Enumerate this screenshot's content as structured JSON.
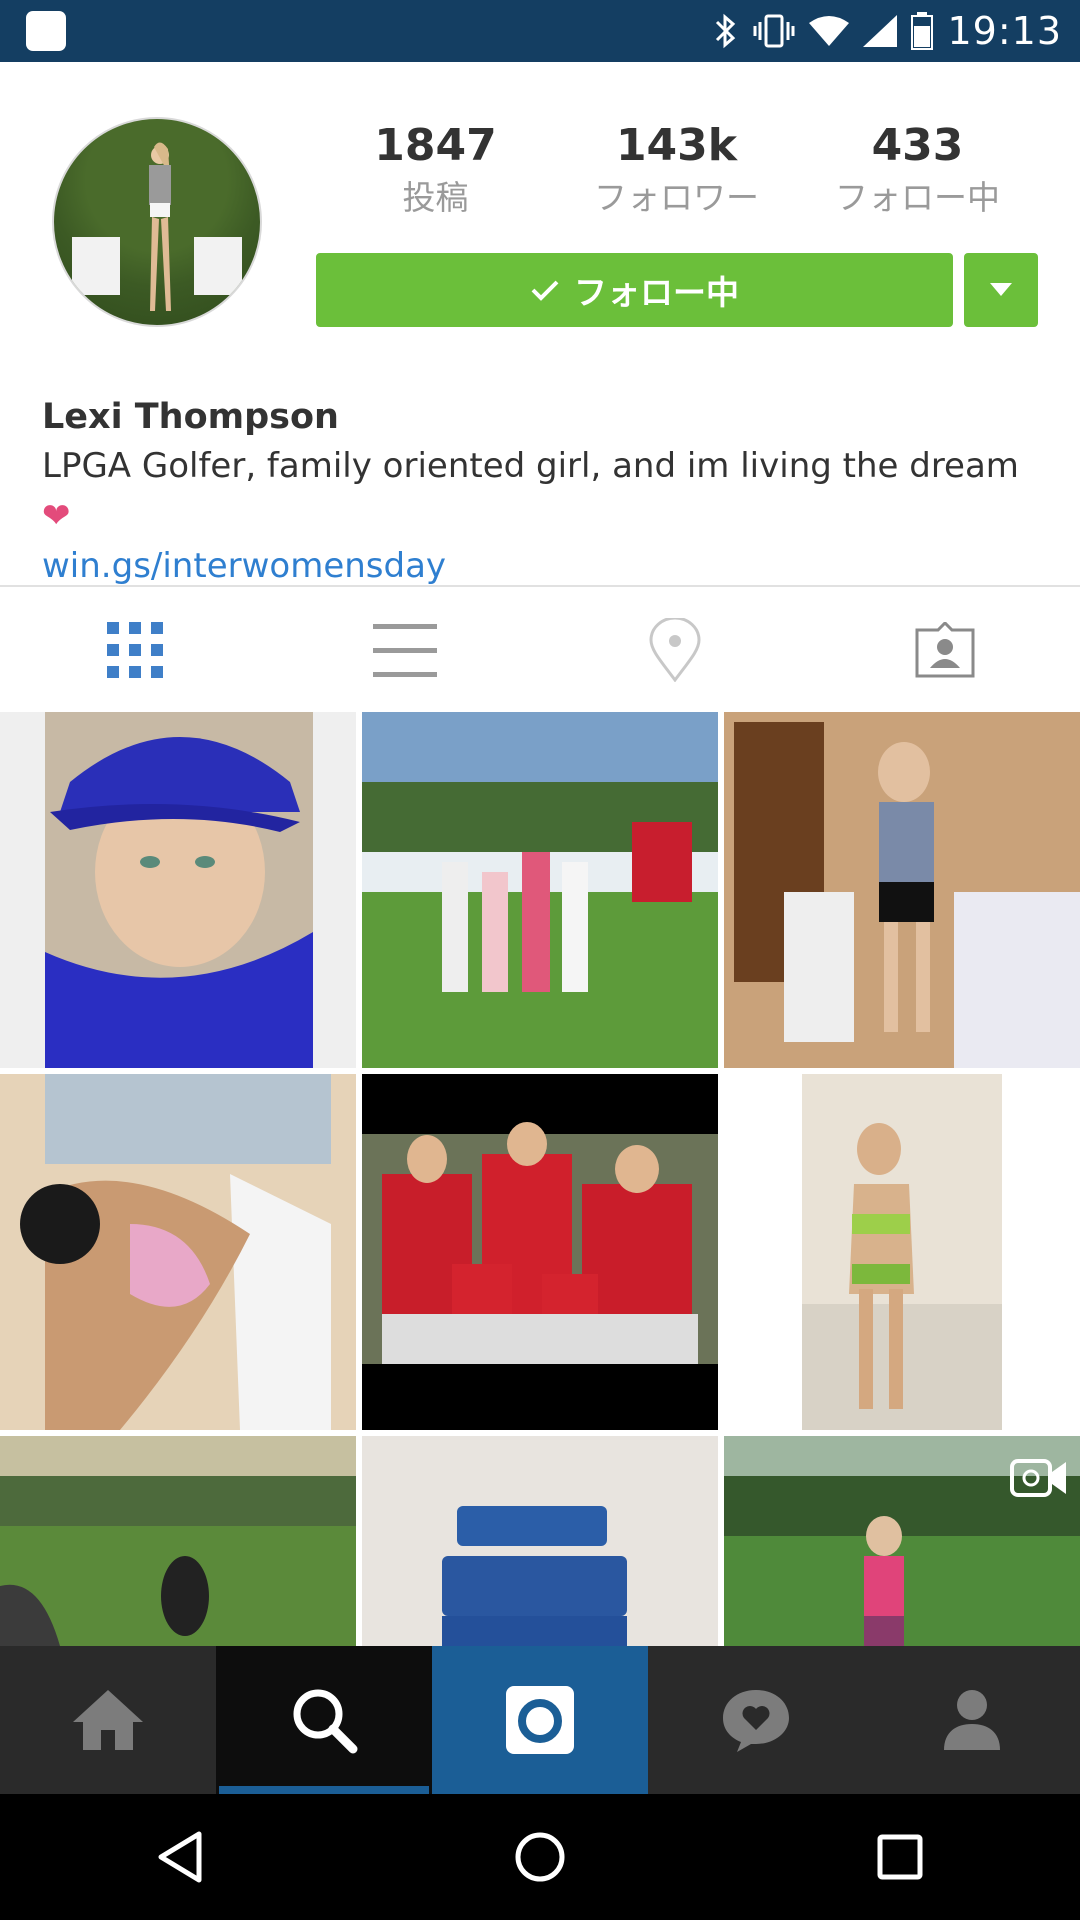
{
  "status_bar": {
    "time": "19:13",
    "icons": [
      "app-icon",
      "bluetooth-icon",
      "vibrate-icon",
      "wifi-icon",
      "signal-icon",
      "battery-icon"
    ]
  },
  "profile": {
    "stats": [
      {
        "value": "1847",
        "label": "投稿"
      },
      {
        "value": "143k",
        "label": "フォロワー"
      },
      {
        "value": "433",
        "label": "フォロー中"
      }
    ],
    "follow_button_label": "フォロー中",
    "name": "Lexi Thompson",
    "bio": "LPGA Golfer, family oriented girl, and im living the dream",
    "bio_emoji": "❤",
    "link": "win.gs/interwomensday"
  },
  "tabs": [
    "grid-icon",
    "list-icon",
    "location-pin-icon",
    "tagged-icon"
  ],
  "grid_posts": [
    {
      "description": "Red Bull cap selfie"
    },
    {
      "description": "Group photo on golf course"
    },
    {
      "description": "Standing with golf bag in hotel room"
    },
    {
      "description": "Beach selfie"
    },
    {
      "description": "Family photo in red shirts"
    },
    {
      "description": "Mirror selfie"
    },
    {
      "description": "Golf course landscape"
    },
    {
      "description": "Blue cases"
    },
    {
      "description": "Golf swing video"
    }
  ],
  "bottom_nav": [
    "home-icon",
    "search-icon",
    "camera-icon",
    "activity-heart-icon",
    "profile-icon"
  ],
  "system_nav": [
    "back-icon",
    "home-circle-icon",
    "recents-icon"
  ],
  "colors": {
    "status_bar": "#143e62",
    "follow_green": "#6bbf3a",
    "link_blue": "#2f7fd0",
    "accent_blue": "#1b5e96",
    "heart_pink": "#e34b7b"
  }
}
